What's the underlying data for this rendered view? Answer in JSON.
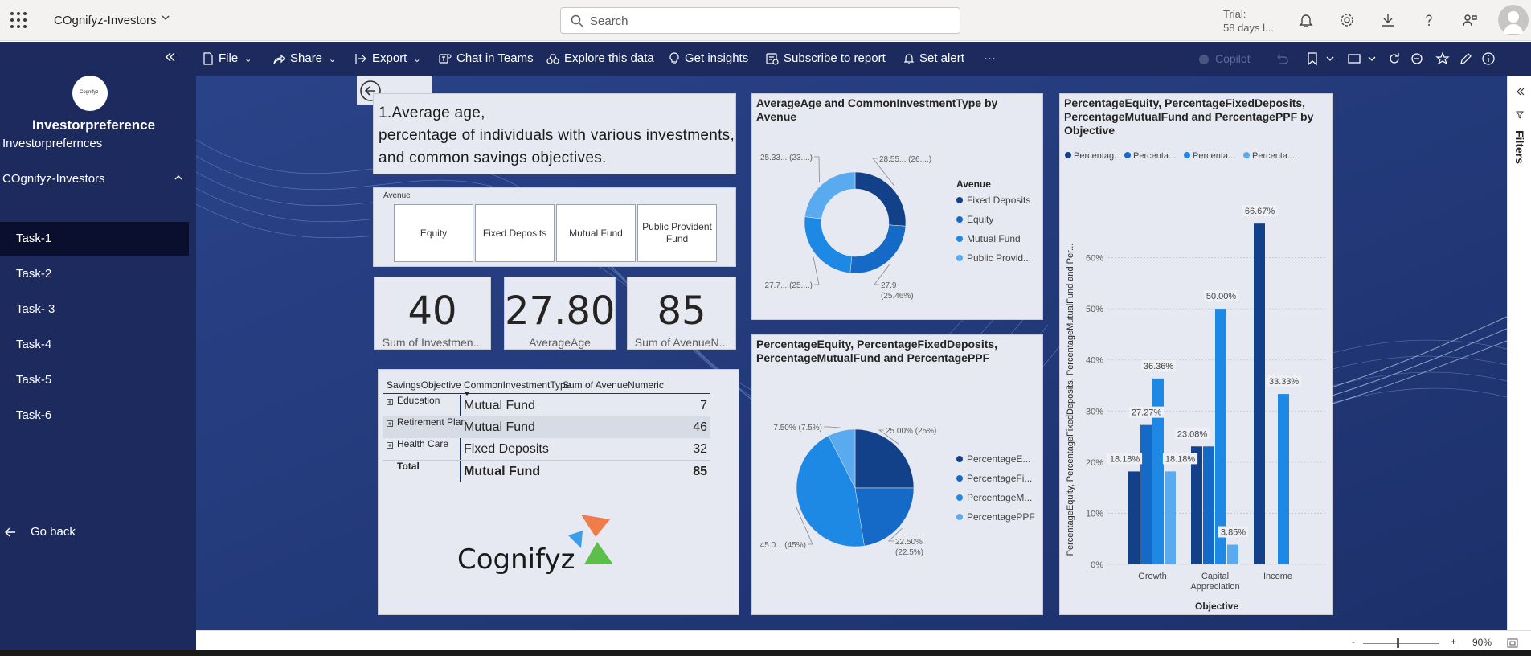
{
  "topbar": {
    "workspace": "COgnifyz-Investors",
    "search_placeholder": "Search",
    "trial_line1": "Trial:",
    "trial_line2": "58 days l..."
  },
  "sidebar": {
    "app_title": "Investorpreference",
    "logo_text": "Cognifyz",
    "items": [
      {
        "label": "Investorprefernces"
      },
      {
        "label": "COgnifyz-Investors"
      },
      {
        "label": "Task-1"
      },
      {
        "label": "Task-2"
      },
      {
        "label": "Task- 3"
      },
      {
        "label": "Task-4"
      },
      {
        "label": "Task-5"
      },
      {
        "label": "Task-6"
      }
    ],
    "go_back": "Go back"
  },
  "actionbar": {
    "file": "File",
    "share": "Share",
    "export": "Export",
    "teams": "Chat in Teams",
    "explore": "Explore this data",
    "insights": "Get insights",
    "subscribe": "Subscribe to report",
    "alert": "Set alert",
    "more": "···",
    "copilot": "Copilot"
  },
  "filters_label": "Filters",
  "report": {
    "title": "1.Average age,\npercentage of individuals with various investments, and common savings objectives.",
    "slicer": {
      "label": "Avenue",
      "options": [
        "Equity",
        "Fixed Deposits",
        "Mutual Fund",
        "Public Provident Fund"
      ]
    },
    "kpis": [
      {
        "value": "40",
        "label": "Sum of Investmen..."
      },
      {
        "value": "27.80",
        "label": "AverageAge"
      },
      {
        "value": "85",
        "label": "Sum of AvenueN..."
      }
    ],
    "table": {
      "headers": [
        "SavingsObjective",
        "CommonInvestmentType",
        "Sum of AvenueNumeric"
      ],
      "rows": [
        {
          "objective": "Education",
          "type": "Mutual Fund",
          "sum": "7"
        },
        {
          "objective": "Retirement Plan",
          "type": "Mutual Fund",
          "sum": "46"
        },
        {
          "objective": "Health Care",
          "type": "Fixed Deposits",
          "sum": "32"
        }
      ],
      "total": {
        "label": "Total",
        "type": "Mutual Fund",
        "sum": "85"
      }
    },
    "brand": "Cognifyz"
  },
  "status": {
    "zoom": "90%"
  },
  "chart_data": [
    {
      "type": "pie",
      "variant": "donut",
      "title": "AverageAge and CommonInvestmentType by Avenue",
      "legend_title": "Avenue",
      "categories": [
        "Fixed Deposits",
        "Equity",
        "Mutual Fund",
        "Public Provid..."
      ],
      "values": [
        28.55,
        27.9,
        27.7,
        25.33
      ],
      "data_labels": [
        "28.55... (26....)",
        "27.9\n(25.46%)",
        "27.7... (25....)",
        "25.33... (23....)"
      ],
      "colors": [
        "#12418a",
        "#1569c7",
        "#1e88e5",
        "#5aaaf0"
      ],
      "legend_position": "right"
    },
    {
      "type": "pie",
      "title": "PercentageEquity, PercentageFixedDeposits, PercentageMutualFund and PercentagePPF",
      "categories": [
        "PercentageE...",
        "PercentageFi...",
        "PercentageM...",
        "PercentagePPF"
      ],
      "values": [
        25,
        22.5,
        45,
        7.5
      ],
      "data_labels": [
        "25.00% (25%)",
        "22.50%\n(22.5%)",
        "45.0... (45%)",
        "7.50% (7.5%)"
      ],
      "colors": [
        "#12418a",
        "#1569c7",
        "#1e88e5",
        "#5aaaf0"
      ],
      "legend_position": "right"
    },
    {
      "type": "bar",
      "title": "PercentageEquity, PercentageFixedDeposits, PercentageMutualFund and PercentagePPF by Objective",
      "xlabel": "Objective",
      "ylabel": "PercentageEquity, PercentageFixedDeposits, PercentageMutualFund and Per...",
      "categories": [
        "Growth",
        "Capital\nAppreciation",
        "Income"
      ],
      "series": [
        {
          "name": "Percentag...",
          "values": [
            18.18,
            23.08,
            66.67
          ],
          "color": "#12418a"
        },
        {
          "name": "Percenta...",
          "values": [
            27.27,
            23.08,
            0
          ],
          "color": "#1569c7"
        },
        {
          "name": "Percenta...",
          "values": [
            36.36,
            50.0,
            33.33
          ],
          "color": "#1e88e5"
        },
        {
          "name": "Percenta...",
          "values": [
            18.18,
            3.85,
            0
          ],
          "color": "#5aaaf0"
        }
      ],
      "data_labels": [
        {
          "series": 0,
          "cat": 0,
          "text": "18.18%"
        },
        {
          "series": 1,
          "cat": 0,
          "text": "27.27%"
        },
        {
          "series": 2,
          "cat": 0,
          "text": "36.36%"
        },
        {
          "series": 3,
          "cat": 0,
          "text": "18.18%"
        },
        {
          "series": 0,
          "cat": 1,
          "text": "23.08%"
        },
        {
          "series": 2,
          "cat": 1,
          "text": "50.00%"
        },
        {
          "series": 3,
          "cat": 1,
          "text": "3.85%"
        },
        {
          "series": 0,
          "cat": 2,
          "text": "66.67%"
        },
        {
          "series": 2,
          "cat": 2,
          "text": "33.33%"
        }
      ],
      "yticks": [
        "0%",
        "10%",
        "20%",
        "30%",
        "40%",
        "50%",
        "60%"
      ],
      "ylim": [
        0,
        70
      ],
      "legend_position": "top-left"
    }
  ]
}
